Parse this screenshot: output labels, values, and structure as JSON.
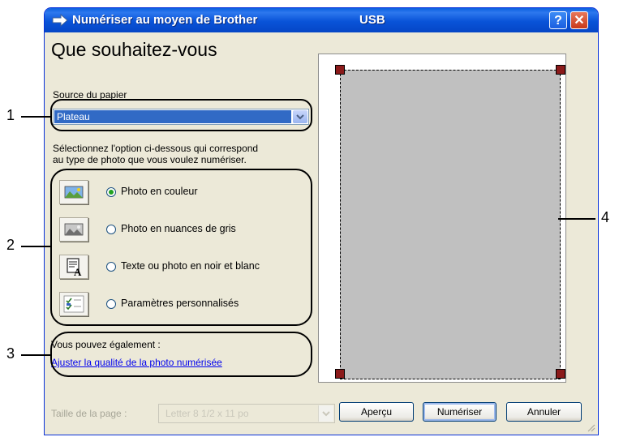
{
  "window": {
    "title": "Numériser au moyen de Brother",
    "connection": "USB",
    "help_icon": "?",
    "close_icon": "✕"
  },
  "left_panel": {
    "heading": "Que souhaitez-vous",
    "paper_source_label": "Source du papier",
    "paper_source_value": "Plateau",
    "instruction_line1": "Sélectionnez l'option ci-dessous qui correspond",
    "instruction_line2": "au type de photo que vous voulez numériser.",
    "options": [
      {
        "label": "Photo en couleur",
        "icon": "color-photo-icon",
        "selected": true
      },
      {
        "label": "Photo en nuances de gris",
        "icon": "grayscale-photo-icon",
        "selected": false
      },
      {
        "label": "Texte ou photo en noir et blanc",
        "icon": "text-bw-icon",
        "selected": false
      },
      {
        "label": "Paramètres personnalisés",
        "icon": "custom-settings-icon",
        "selected": false
      }
    ],
    "also_label": "Vous pouvez également :",
    "quality_link": "Ajuster la qualité de la photo numérisée"
  },
  "bottom": {
    "page_size_label": "Taille de la page :",
    "page_size_value": "Letter 8 1/2 x 11 po",
    "preview_button": "Aperçu",
    "scan_button": "Numériser",
    "cancel_button": "Annuler"
  },
  "callouts": [
    "1",
    "2",
    "3",
    "4"
  ],
  "colors": {
    "titlebar": "#0a5fe0",
    "selection": "#316ac5",
    "link": "#0000ee",
    "scan_area": "#c0c0c0",
    "handle": "#8b1a1a"
  }
}
